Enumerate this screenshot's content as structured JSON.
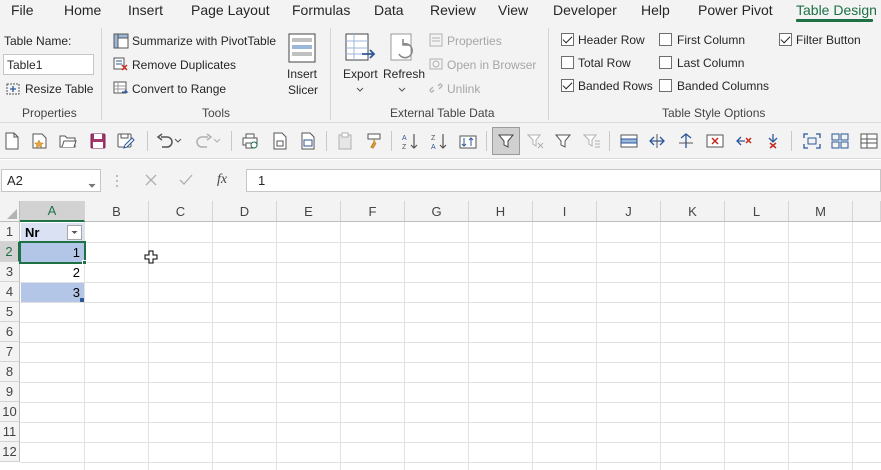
{
  "tabs": [
    {
      "label": "File",
      "active": false
    },
    {
      "label": "Home",
      "active": false
    },
    {
      "label": "Insert",
      "active": false
    },
    {
      "label": "Page Layout",
      "active": false
    },
    {
      "label": "Formulas",
      "active": false
    },
    {
      "label": "Data",
      "active": false
    },
    {
      "label": "Review",
      "active": false
    },
    {
      "label": "View",
      "active": false
    },
    {
      "label": "Developer",
      "active": false
    },
    {
      "label": "Help",
      "active": false
    },
    {
      "label": "Power Pivot",
      "active": false
    },
    {
      "label": "Table Design",
      "active": true
    }
  ],
  "ribbon": {
    "properties": {
      "table_name_label": "Table Name:",
      "table_name_value": "Table1",
      "resize_table": "Resize Table",
      "group_label": "Properties"
    },
    "tools": {
      "summarize_pivot": "Summarize with PivotTable",
      "remove_duplicates": "Remove Duplicates",
      "convert_to_range": "Convert to Range",
      "insert_slicer_line1": "Insert",
      "insert_slicer_line2": "Slicer",
      "group_label": "Tools"
    },
    "external": {
      "export": "Export",
      "refresh": "Refresh",
      "properties": "Properties",
      "open_in_browser": "Open in Browser",
      "unlink": "Unlink",
      "group_label": "External Table Data"
    },
    "style_options": {
      "header_row": "Header Row",
      "total_row": "Total Row",
      "banded_rows": "Banded Rows",
      "first_column": "First Column",
      "last_column": "Last Column",
      "banded_columns": "Banded Columns",
      "filter_button": "Filter Button",
      "header_row_checked": true,
      "total_row_checked": false,
      "banded_rows_checked": true,
      "first_column_checked": false,
      "last_column_checked": false,
      "banded_columns_checked": false,
      "filter_button_checked": true,
      "group_label": "Table Style Options"
    }
  },
  "formula_bar": {
    "name_box": "A2",
    "fx_label": "fx",
    "formula": "1"
  },
  "sheet": {
    "columns": [
      "A",
      "B",
      "C",
      "D",
      "E",
      "F",
      "G",
      "H",
      "I",
      "J",
      "K",
      "L",
      "M"
    ],
    "rows": [
      "1",
      "2",
      "3",
      "4",
      "5",
      "6",
      "7",
      "8",
      "9",
      "10",
      "11",
      "12"
    ],
    "selected_column": "A",
    "selected_row": "2",
    "table": {
      "header": "Nr",
      "values": [
        "1",
        "2",
        "3"
      ]
    }
  },
  "colors": {
    "accent": "#1e7145",
    "banded_row": "#b4c6e7",
    "header_fill": "#d9e1f2",
    "ribbon_bg": "#f3f3f3"
  }
}
